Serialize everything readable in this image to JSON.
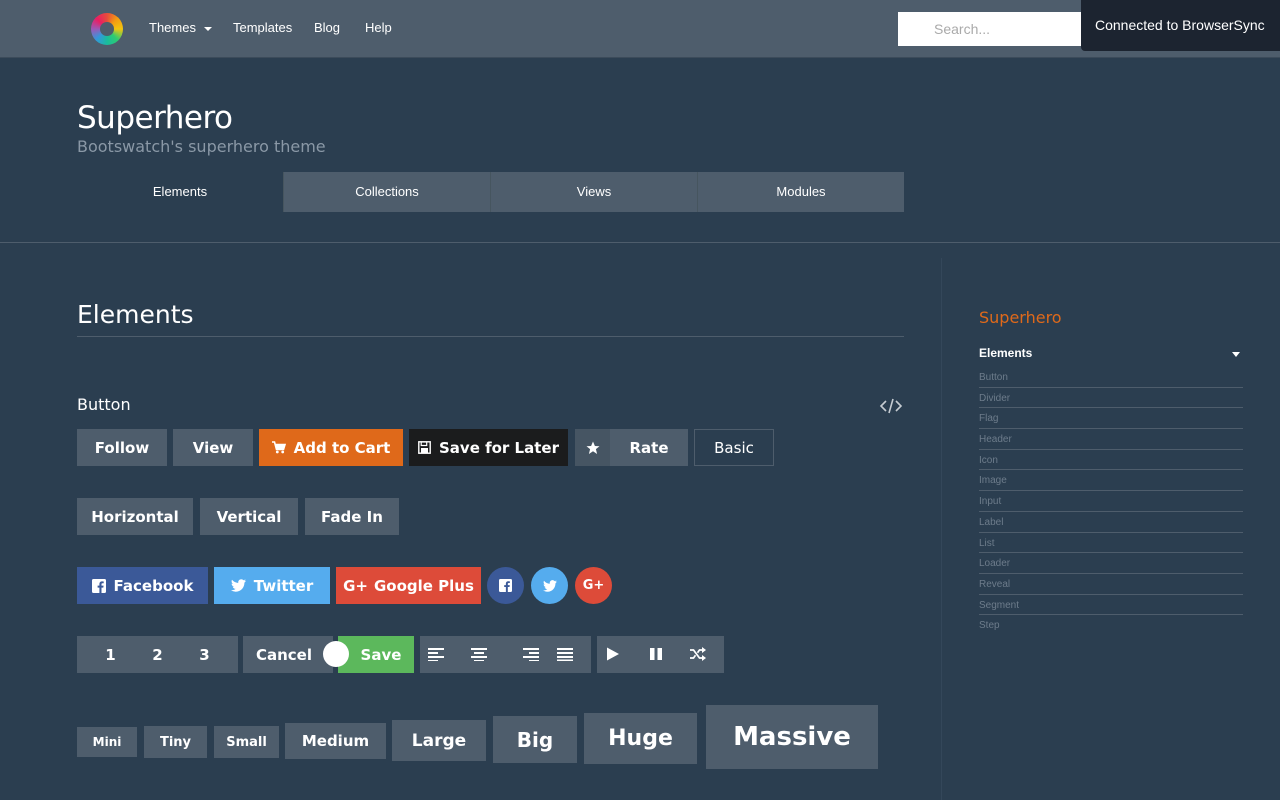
{
  "nav": {
    "items": [
      "Themes",
      "Templates",
      "Blog",
      "Help"
    ],
    "search_placeholder": "Search..."
  },
  "toast": "Connected to BrowserSync",
  "header": {
    "title": "Superhero",
    "subtitle": "Bootswatch's superhero theme",
    "tabs": [
      "Elements",
      "Collections",
      "Views",
      "Modules"
    ],
    "active_tab": "Elements"
  },
  "main": {
    "section_title": "Elements",
    "subsection_title": "Button",
    "row1": {
      "follow": "Follow",
      "view": "View",
      "add_to_cart": "Add to Cart",
      "save_for_later": "Save for Later",
      "rate": "Rate",
      "basic": "Basic"
    },
    "row2": {
      "horizontal": "Horizontal",
      "vertical": "Vertical",
      "fade_in": "Fade In"
    },
    "row3": {
      "facebook": "Facebook",
      "twitter": "Twitter",
      "google_plus": "Google Plus"
    },
    "row4": {
      "pages": [
        "1",
        "2",
        "3"
      ],
      "cancel": "Cancel",
      "save": "Save"
    },
    "sizes": [
      "Mini",
      "Tiny",
      "Small",
      "Medium",
      "Large",
      "Big",
      "Huge",
      "Massive"
    ]
  },
  "sidebar": {
    "title": "Superhero",
    "section": "Elements",
    "items": [
      "Button",
      "Divider",
      "Flag",
      "Header",
      "Icon",
      "Image",
      "Input",
      "Label",
      "List",
      "Loader",
      "Reveal",
      "Segment",
      "Step"
    ]
  },
  "colors": {
    "background": "#2b3e50",
    "primary": "#4e5d6c",
    "accent": "#df691a",
    "facebook": "#3b5998",
    "twitter": "#55acee",
    "google_plus": "#dd4b39",
    "positive": "#5cb85c"
  }
}
